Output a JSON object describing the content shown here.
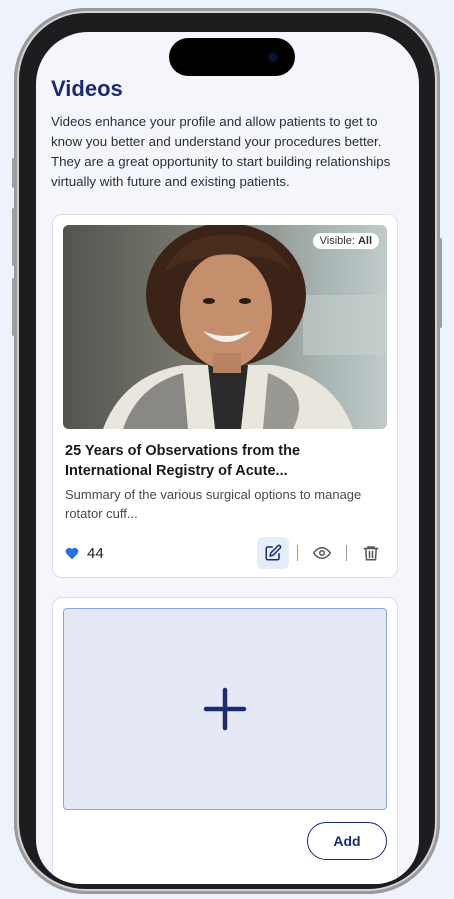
{
  "page": {
    "title": "Videos",
    "description": "Videos enhance your profile and allow patients to get to know you better and understand your procedures better. They are a great opportunity to start building relationships virtually with future and existing patients."
  },
  "video": {
    "visibility_label": "Visible:",
    "visibility_value": "All",
    "title": "25 Years of Observations from the International Registry of Acute...",
    "summary": "Summary of the various surgical options to manage rotator cuff...",
    "likes": "44",
    "like_icon": "heart-icon",
    "action_icons": [
      "edit-icon",
      "eye-icon",
      "trash-icon"
    ]
  },
  "upload": {
    "icon": "plus-icon",
    "add_label": "Add"
  },
  "colors": {
    "brand": "#1c2a72",
    "heart": "#2a6fe0",
    "background": "#eef2fb"
  }
}
